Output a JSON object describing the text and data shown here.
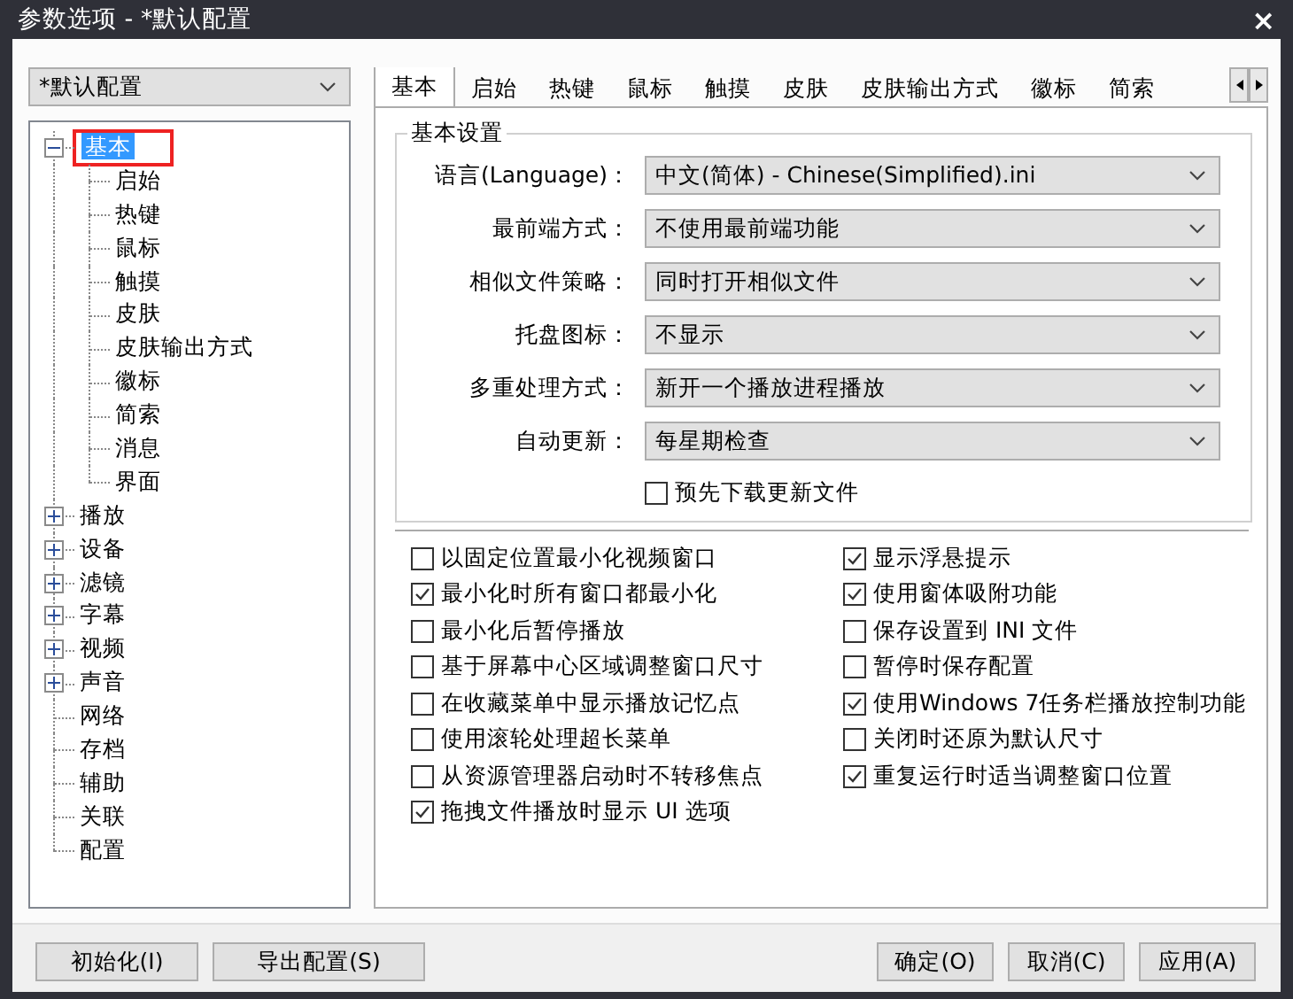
{
  "window": {
    "title": "参数选项 - *默认配置",
    "close": "×"
  },
  "profile": {
    "value": "*默认配置"
  },
  "tree": [
    {
      "label": "基本",
      "selected": true,
      "annotated": true,
      "expanded": true,
      "children": [
        {
          "label": "启始",
          "selected": false
        },
        {
          "label": "热键",
          "selected": false
        },
        {
          "label": "鼠标",
          "selected": false
        },
        {
          "label": "触摸",
          "selected": false
        },
        {
          "label": "皮肤",
          "selected": false
        },
        {
          "label": "皮肤输出方式",
          "selected": false
        },
        {
          "label": "徽标",
          "selected": false
        },
        {
          "label": "简索",
          "selected": false
        },
        {
          "label": "消息",
          "selected": false
        },
        {
          "label": "界面",
          "selected": false
        }
      ]
    },
    {
      "label": "播放",
      "selected": false,
      "expanded": false
    },
    {
      "label": "设备",
      "selected": false,
      "expanded": false
    },
    {
      "label": "滤镜",
      "selected": false,
      "expanded": false
    },
    {
      "label": "字幕",
      "selected": false,
      "expanded": false
    },
    {
      "label": "视频",
      "selected": false,
      "expanded": false
    },
    {
      "label": "声音",
      "selected": false,
      "expanded": false
    },
    {
      "label": "网络",
      "selected": false
    },
    {
      "label": "存档",
      "selected": false
    },
    {
      "label": "辅助",
      "selected": false
    },
    {
      "label": "关联",
      "selected": false
    },
    {
      "label": "配置",
      "selected": false
    }
  ],
  "tabs": [
    {
      "label": "基本",
      "selected": true
    },
    {
      "label": "启始",
      "selected": false
    },
    {
      "label": "热键",
      "selected": false
    },
    {
      "label": "鼠标",
      "selected": false
    },
    {
      "label": "触摸",
      "selected": false
    },
    {
      "label": "皮肤",
      "selected": false
    },
    {
      "label": "皮肤输出方式",
      "selected": false
    },
    {
      "label": "徽标",
      "selected": false
    },
    {
      "label": "简索",
      "selected": false
    }
  ],
  "group": {
    "title": "基本设置",
    "settings": [
      {
        "label": "语言(Language)：",
        "value": "中文(简体) - Chinese(Simplified).ini"
      },
      {
        "label": "最前端方式：",
        "value": "不使用最前端功能"
      },
      {
        "label": "相似文件策略：",
        "value": "同时打开相似文件"
      },
      {
        "label": "托盘图标：",
        "value": "不显示"
      },
      {
        "label": "多重处理方式：",
        "value": "新开一个播放进程播放"
      },
      {
        "label": "自动更新：",
        "value": "每星期检查"
      }
    ],
    "update_option": {
      "label": "预先下载更新文件",
      "checked": false
    }
  },
  "options": [
    {
      "label": "以固定位置最小化视频窗口",
      "checked": false
    },
    {
      "label": "显示浮悬提示",
      "checked": true
    },
    {
      "label": "最小化时所有窗口都最小化",
      "checked": true
    },
    {
      "label": "使用窗体吸附功能",
      "checked": true
    },
    {
      "label": "最小化后暂停播放",
      "checked": false
    },
    {
      "label": "保存设置到 INI 文件",
      "checked": false
    },
    {
      "label": "基于屏幕中心区域调整窗口尺寸",
      "checked": false
    },
    {
      "label": "暂停时保存配置",
      "checked": false
    },
    {
      "label": "在收藏菜单中显示播放记忆点",
      "checked": false
    },
    {
      "label": "使用Windows 7任务栏播放控制功能",
      "checked": true
    },
    {
      "label": "使用滚轮处理超长菜单",
      "checked": false
    },
    {
      "label": "关闭时还原为默认尺寸",
      "checked": false
    },
    {
      "label": "从资源管理器启动时不转移焦点",
      "checked": false
    },
    {
      "label": "重复运行时适当调整窗口位置",
      "checked": true
    },
    {
      "label": "拖拽文件播放时显示 UI 选项",
      "checked": true
    }
  ],
  "buttons_left": [
    "初始化(I)",
    "导出配置(S)"
  ],
  "buttons_right": [
    "确定(O)",
    "取消(C)",
    "应用(A)"
  ]
}
